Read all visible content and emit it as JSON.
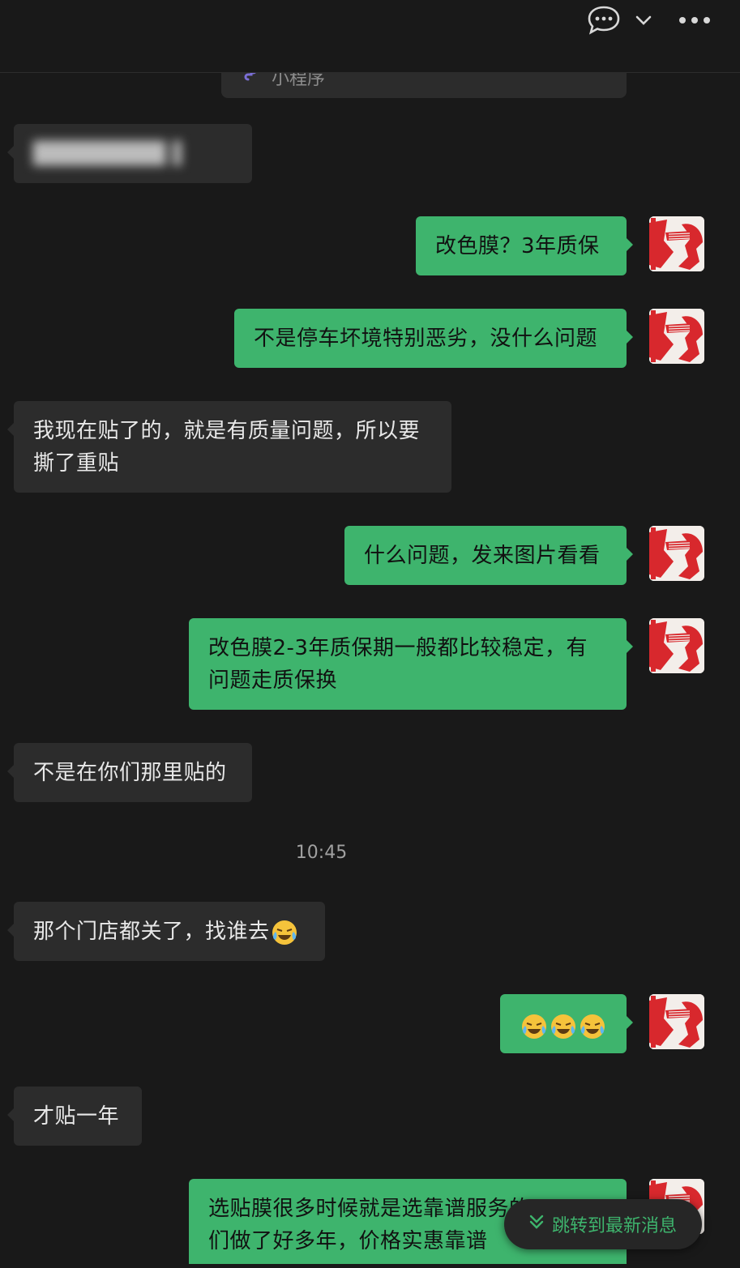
{
  "topbar": {
    "chat_icon": "chat-bubble-icon",
    "chevron_icon": "chevron-down-icon",
    "more_icon": "more-icon"
  },
  "mini_program": {
    "label": "小程序",
    "icon": "mini-program-icon"
  },
  "messages": [
    {
      "dir": "in",
      "text": ""
    },
    {
      "dir": "out",
      "text": "改色膜？3年质保"
    },
    {
      "dir": "out",
      "text": "不是停车坏境特别恶劣，没什么问题"
    },
    {
      "dir": "in",
      "line1": "我现在贴了的，就是有质量问题，所以要",
      "line2": "撕了重贴"
    },
    {
      "dir": "out",
      "text": "什么问题，发来图片看看"
    },
    {
      "dir": "out",
      "line1": "改色膜2-3年质保期一般都比较稳定，有",
      "line2": "问题走质保换"
    },
    {
      "dir": "in",
      "text": "不是在你们那里贴的"
    },
    {
      "dir": "in",
      "text": "那个门店都关了，找谁去"
    },
    {
      "dir": "out",
      "emoji_count": 3
    },
    {
      "dir": "in",
      "text": "才贴一年"
    },
    {
      "dir": "out",
      "line1": "选贴膜很多时候就是选靠谱服务的",
      "line2": "们做了好多年，价格实惠靠谱"
    }
  ],
  "timestamp": "10:45",
  "jump_button": {
    "label": "跳转到最新消息",
    "icon": "double-chevron-down-icon"
  },
  "colors": {
    "background": "#191919",
    "incoming": "#2c2c2c",
    "outgoing": "#3eb46d",
    "accent": "#3eb46d"
  }
}
